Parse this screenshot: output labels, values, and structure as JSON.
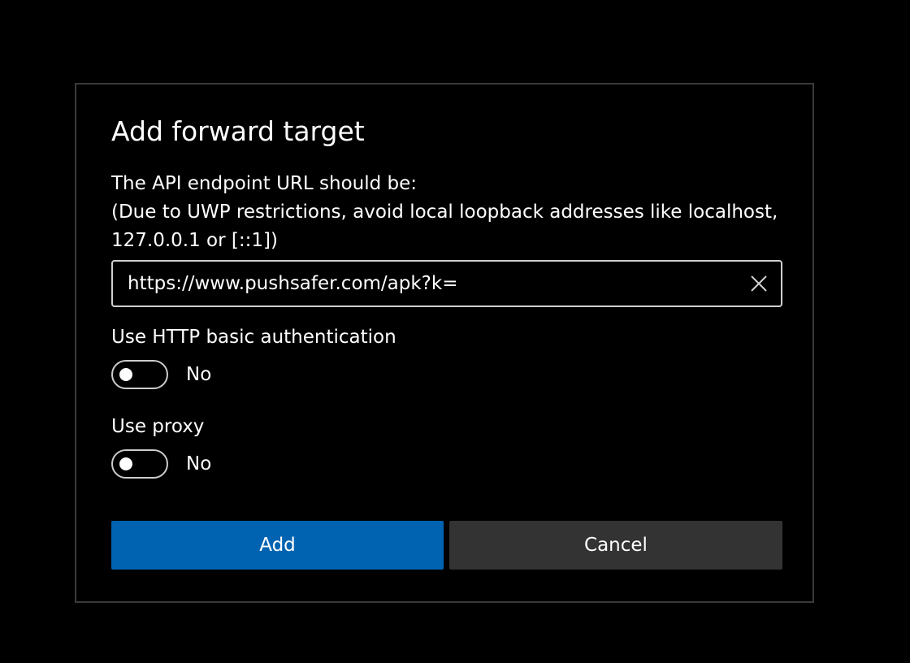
{
  "dialog": {
    "title": "Add forward target",
    "description_lines": [
      "The API endpoint URL should be:",
      "(Due to UWP restrictions, avoid local loopback addresses like localhost,",
      "127.0.0.1 or [::1])"
    ],
    "url_input": {
      "value": "https://www.pushsafer.com/apk?k=",
      "clear_icon": "close-icon"
    },
    "basic_auth": {
      "label": "Use HTTP basic authentication",
      "state_text": "No",
      "on": false
    },
    "proxy": {
      "label": "Use proxy",
      "state_text": "No",
      "on": false
    },
    "buttons": {
      "primary_label": "Add",
      "secondary_label": "Cancel"
    }
  },
  "colors": {
    "background": "#000000",
    "border": "#3a3a3a",
    "accent": "#0063b1",
    "secondary_button": "#333333",
    "text": "#ffffff"
  }
}
